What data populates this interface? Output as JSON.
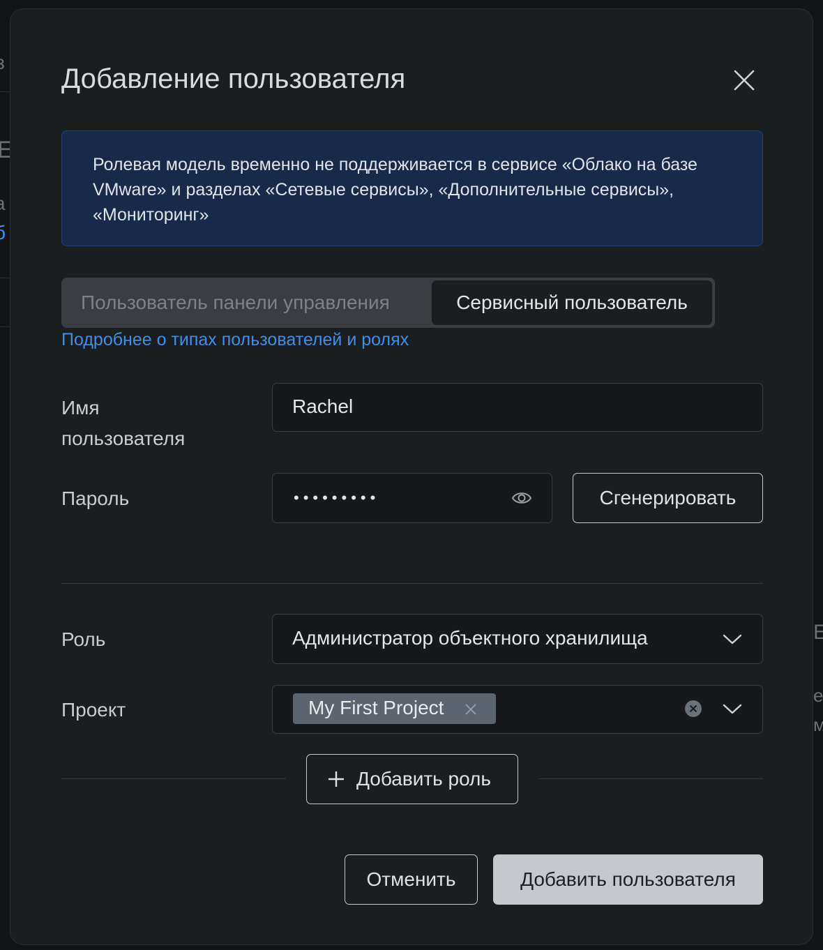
{
  "dialog": {
    "title": "Добавление пользователя",
    "info": "Ролевая модель временно не поддерживается в сервисе «Облако на базе VMware» и разделах «Сетевые сервисы», «Дополнительные сервисы», «Мониторинг»",
    "tabs": [
      {
        "label": "Пользователь панели управления",
        "active": false
      },
      {
        "label": "Сервисный пользователь",
        "active": true
      }
    ],
    "learn_more_link": "Подробнее о типах пользователей и ролях",
    "username": {
      "label": "Имя пользователя",
      "value": "Rachel"
    },
    "password": {
      "label": "Пароль",
      "masked_value": "•••••••••",
      "generate_label": "Сгенерировать"
    },
    "role": {
      "label": "Роль",
      "selected": "Администратор объектного хранилища"
    },
    "project": {
      "label": "Проект",
      "tags": [
        "My First Project"
      ]
    },
    "add_role_label": "Добавить роль",
    "cancel_label": "Отменить",
    "submit_label": "Добавить пользователя"
  },
  "colors": {
    "accent_link": "#3f8fe8",
    "info_bg": "#172a49",
    "modal_bg": "#1b1e21"
  }
}
